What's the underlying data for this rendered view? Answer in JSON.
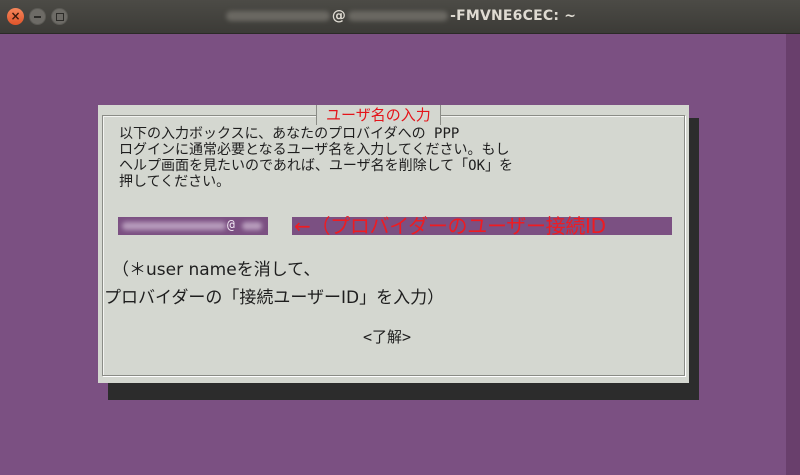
{
  "window": {
    "title_at": "@",
    "title_suffix": "-FMVNE6CEC: ~",
    "close_symbol": "×"
  },
  "dialog": {
    "title": "ユーザ名の入力",
    "body_lines": [
      "以下の入力ボックスに、あなたのプロバイダへの PPP",
      "ログインに通常必要となるユーザ名を入力してください。もし",
      "ヘルプ画面を見たいのであれば、ユーザ名を削除して「OK」を",
      "押してください。"
    ],
    "input_visible_value": "@",
    "annotation": "←（プロバイダーのユーザー接続ID",
    "note_line1": "（＊user nameを消して、",
    "note_line2": "プロバイダーの「接続ユーザーID」を入力）",
    "ok_label": "<了解>"
  },
  "colors": {
    "desktop_bg": "#7b5082",
    "dialog_bg": "#d4d7d0",
    "title_red": "#e4141a",
    "annotation_red": "#ee1c22",
    "titlebar": "#3c3b37"
  }
}
